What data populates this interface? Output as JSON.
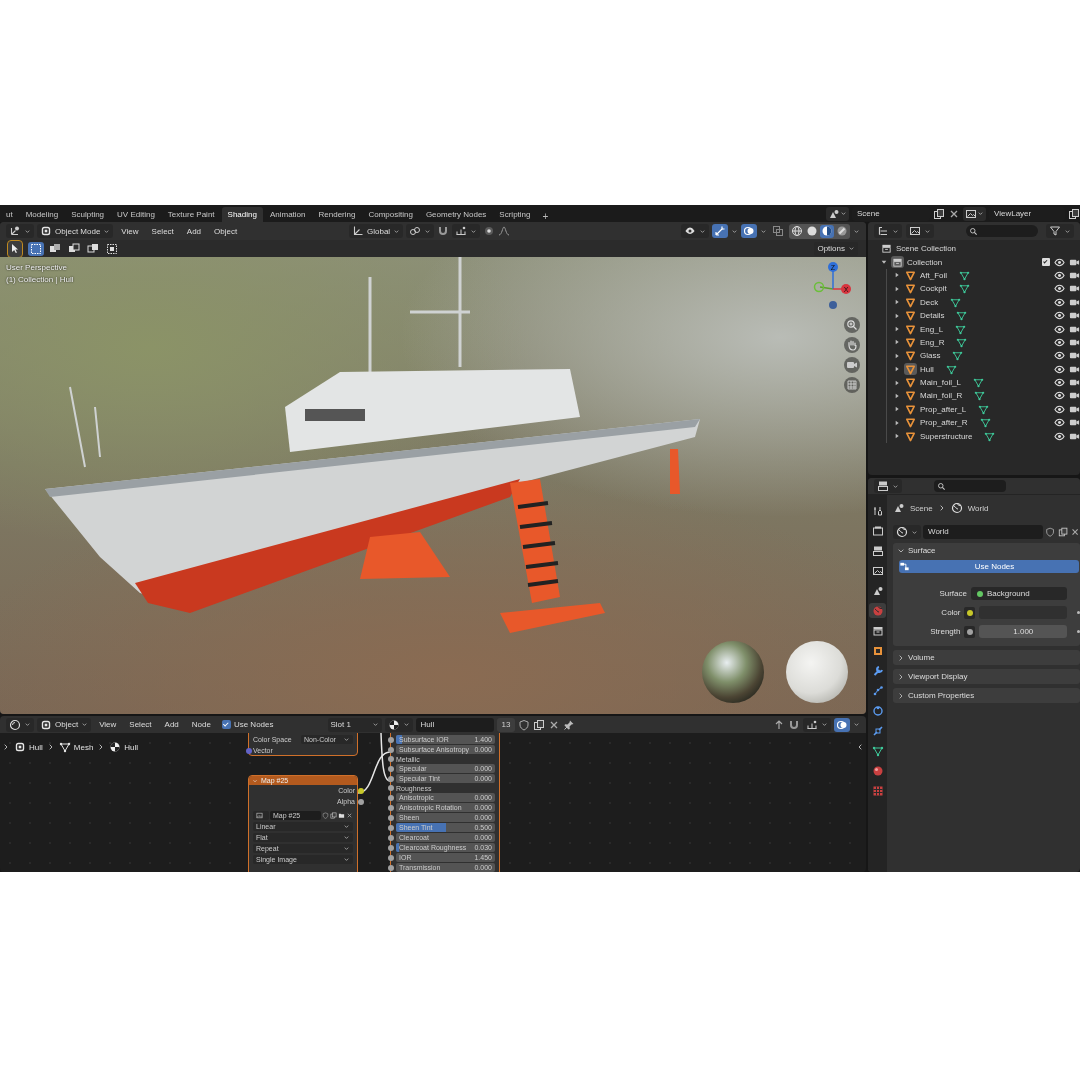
{
  "workspace_tabs": [
    {
      "label": "ut",
      "selected": false
    },
    {
      "label": "Modeling",
      "selected": false
    },
    {
      "label": "Sculpting",
      "selected": false
    },
    {
      "label": "UV Editing",
      "selected": false
    },
    {
      "label": "Texture Paint",
      "selected": false
    },
    {
      "label": "Shading",
      "selected": true
    },
    {
      "label": "Animation",
      "selected": false
    },
    {
      "label": "Rendering",
      "selected": false
    },
    {
      "label": "Compositing",
      "selected": false
    },
    {
      "label": "Geometry Nodes",
      "selected": false
    },
    {
      "label": "Scripting",
      "selected": false
    }
  ],
  "add_workspace": "+",
  "scene": "Scene",
  "view_layer": "ViewLayer",
  "viewport": {
    "mode": "Object Mode",
    "menus": [
      "View",
      "Select",
      "Add",
      "Object"
    ],
    "orientation": "Global",
    "toggles": [
      {
        "kind": "gizmo",
        "on": true
      },
      {
        "kind": "overlays",
        "on": true
      },
      {
        "kind": "xray",
        "on": false
      }
    ],
    "shading_modes": [
      {
        "kind": "wireframe",
        "selected": false
      },
      {
        "kind": "solid",
        "selected": false
      },
      {
        "kind": "material",
        "selected": true
      },
      {
        "kind": "rendered",
        "selected": false
      }
    ],
    "select_modes": [
      {
        "kind": "new",
        "selected": true
      },
      {
        "kind": "extend",
        "selected": false
      },
      {
        "kind": "subtract",
        "selected": false
      },
      {
        "kind": "invert",
        "selected": false
      },
      {
        "kind": "intersect",
        "selected": false
      }
    ],
    "options": "Options",
    "overlay_lines": [
      "User Perspective",
      "(1) Collection | Hull"
    ],
    "axes": [
      {
        "label": "Z",
        "color": "#2f6fd8"
      },
      {
        "label": "X",
        "color": "#d8343e"
      }
    ]
  },
  "node_editor": {
    "object_mode": "Object",
    "menus": [
      "View",
      "Select",
      "Add",
      "Node"
    ],
    "use_nodes": {
      "label": "Use Nodes",
      "checked": true
    },
    "slot": "Slot 1",
    "material": "Hull",
    "users": "13",
    "breadcrumb": [
      {
        "kind": "object",
        "label": "Hull"
      },
      {
        "kind": "mesh",
        "label": "Mesh"
      },
      {
        "kind": "material",
        "label": "Hull"
      }
    ],
    "texture_node": {
      "fields": [
        {
          "label": "Color Space",
          "value": "Non-Color"
        }
      ],
      "inputs": [
        "Vector"
      ]
    },
    "map_node": {
      "title": "Map #25",
      "outputs": [
        {
          "label": "Color",
          "color": "#c7c729"
        },
        {
          "label": "Alpha",
          "color": "#a1a1a1"
        }
      ],
      "image": "Map #25",
      "options": [
        "Linear",
        "Flat",
        "Repeat",
        "Single Image"
      ]
    },
    "bsdf_rows": [
      {
        "kind": "slider",
        "label": "Subsurface IOR",
        "value": "1.400",
        "level": 0.06
      },
      {
        "kind": "slider",
        "label": "Subsurface Anisotropy",
        "value": "0.000",
        "level": 0
      },
      {
        "kind": "input",
        "label": "Metallic"
      },
      {
        "kind": "slider",
        "label": "Specular",
        "value": "0.000",
        "level": 0
      },
      {
        "kind": "slider",
        "label": "Specular Tint",
        "value": "0.000",
        "level": 0
      },
      {
        "kind": "input",
        "label": "Roughness"
      },
      {
        "kind": "slider",
        "label": "Anisotropic",
        "value": "0.000",
        "level": 0
      },
      {
        "kind": "slider",
        "label": "Anisotropic Rotation",
        "value": "0.000",
        "level": 0
      },
      {
        "kind": "slider",
        "label": "Sheen",
        "value": "0.000",
        "level": 0
      },
      {
        "kind": "slider",
        "label": "Sheen Tint",
        "value": "0.500",
        "level": 0.5
      },
      {
        "kind": "slider",
        "label": "Clearcoat",
        "value": "0.000",
        "level": 0
      },
      {
        "kind": "slider",
        "label": "Clearcoat Roughness",
        "value": "0.030",
        "level": 0.03
      },
      {
        "kind": "number",
        "label": "IOR",
        "value": "1.450"
      },
      {
        "kind": "slider",
        "label": "Transmission",
        "value": "0.000",
        "level": 0
      }
    ]
  },
  "outliner": {
    "root": {
      "label": "Scene Collection",
      "children": [
        {
          "label": "Collection",
          "expanded": true,
          "checked": true,
          "children": [
            {
              "label": "Aft_Foil",
              "expanded": false,
              "selected": false
            },
            {
              "label": "Cockpit",
              "expanded": false,
              "selected": false
            },
            {
              "label": "Deck",
              "expanded": false,
              "selected": false
            },
            {
              "label": "Details",
              "expanded": false,
              "selected": false
            },
            {
              "label": "Eng_L",
              "expanded": false,
              "selected": false
            },
            {
              "label": "Eng_R",
              "expanded": false,
              "selected": false
            },
            {
              "label": "Glass",
              "expanded": false,
              "selected": false
            },
            {
              "label": "Hull",
              "expanded": false,
              "selected": true
            },
            {
              "label": "Main_foil_L",
              "expanded": false,
              "selected": false
            },
            {
              "label": "Main_foil_R",
              "expanded": false,
              "selected": false
            },
            {
              "label": "Prop_after_L",
              "expanded": false,
              "selected": false
            },
            {
              "label": "Prop_after_R",
              "expanded": false,
              "selected": false
            },
            {
              "label": "Superstructure",
              "expanded": false,
              "selected": false
            }
          ]
        }
      ]
    }
  },
  "properties": {
    "tabs": [
      {
        "kind": "tool",
        "selected": false
      },
      {
        "kind": "render",
        "selected": false
      },
      {
        "kind": "output",
        "selected": false
      },
      {
        "kind": "view_layer",
        "selected": false
      },
      {
        "kind": "scene",
        "selected": false
      },
      {
        "kind": "world",
        "selected": true
      },
      {
        "kind": "collection",
        "selected": false
      },
      {
        "kind": "object",
        "selected": false
      },
      {
        "kind": "modifier",
        "selected": false
      },
      {
        "kind": "particles",
        "selected": false
      },
      {
        "kind": "physics",
        "selected": false
      },
      {
        "kind": "constraints",
        "selected": false
      },
      {
        "kind": "data",
        "selected": false
      },
      {
        "kind": "material",
        "selected": false
      },
      {
        "kind": "texture",
        "selected": false
      }
    ],
    "breadcrumb": [
      "Scene",
      "World"
    ],
    "world": "World",
    "panels": [
      {
        "title": "Surface",
        "expanded": true,
        "button": "Use Nodes",
        "rows": [
          {
            "kind": "shader",
            "label": "Surface",
            "value": "Background",
            "color": "#63c763"
          },
          {
            "kind": "color",
            "label": "Color",
            "color": "#c7c729"
          },
          {
            "kind": "number",
            "label": "Strength",
            "value": "1.000",
            "color": "#a1a1a1"
          }
        ]
      },
      {
        "title": "Volume",
        "expanded": false
      },
      {
        "title": "Viewport Display",
        "expanded": false
      },
      {
        "title": "Custom Properties",
        "expanded": false
      }
    ]
  }
}
